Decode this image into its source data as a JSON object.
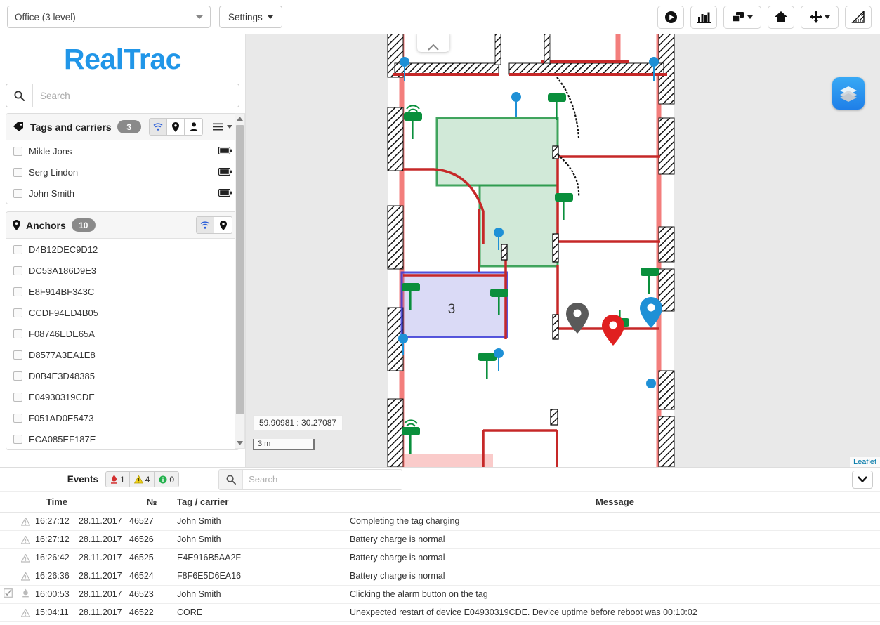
{
  "topbar": {
    "site_select": {
      "value": "Office (3 level)",
      "icon": "chevron-down-icon"
    },
    "settings_label": "Settings",
    "tools": [
      {
        "name": "play-record-button",
        "icon": "play-circle-icon"
      },
      {
        "name": "statistics-button",
        "icon": "bar-chart-icon"
      },
      {
        "name": "windows-layout-button",
        "icon": "windows-icon",
        "has_caret": true
      },
      {
        "name": "home-button",
        "icon": "home-icon"
      },
      {
        "name": "move-tool-button",
        "icon": "move-crosshair-icon",
        "has_caret": true
      },
      {
        "name": "measure-button",
        "icon": "ruler-triangle-icon"
      }
    ]
  },
  "sidebar": {
    "logo_text_1": "Real",
    "logo_text_2": "Trac",
    "logo_color": "#2196e8",
    "search": {
      "placeholder": "Search",
      "value": "",
      "icon": "search-icon"
    },
    "tags_panel": {
      "title": "Tags and carriers",
      "count": "3",
      "icon": "tag-icon",
      "filters": [
        {
          "name": "wifi-filter",
          "icon": "wifi-icon",
          "active": true
        },
        {
          "name": "location-filter",
          "icon": "map-pin-icon",
          "active": false
        },
        {
          "name": "person-filter",
          "icon": "person-icon",
          "active": false
        }
      ],
      "menu_icon": "hamburger-menu-icon",
      "items": [
        {
          "label": "Mikle Jons",
          "battery": "full"
        },
        {
          "label": "Serg Lindon",
          "battery": "full"
        },
        {
          "label": "John Smith",
          "battery": "full"
        }
      ]
    },
    "anchors_panel": {
      "title": "Anchors",
      "count": "10",
      "icon": "map-pin-icon",
      "filters": [
        {
          "name": "wifi-filter",
          "icon": "wifi-icon",
          "active": true
        },
        {
          "name": "location-filter",
          "icon": "map-pin-icon",
          "active": false
        }
      ],
      "items": [
        {
          "label": "D4B12DEC9D12"
        },
        {
          "label": "DC53A186D9E3"
        },
        {
          "label": "E8F914BF343C"
        },
        {
          "label": "CCDF94ED4B05"
        },
        {
          "label": "F08746EDE65A"
        },
        {
          "label": "D8577A3EA1E8"
        },
        {
          "label": "D0B4E3D48385"
        },
        {
          "label": "E04930319CDE"
        },
        {
          "label": "F051AD0E5473"
        },
        {
          "label": "ECA085EF187E"
        }
      ]
    }
  },
  "map": {
    "coordinates": "59.90981 : 30.27087",
    "scale_label": "3 m",
    "attribution": "Leaflet",
    "layers_button_icon": "layers-icon",
    "zone_label": "3",
    "zone_blue_color": "#3333cc",
    "zone_green_color": "#2e9b4e",
    "anchor_dot_color": "#2196e8",
    "alarm_pin_color": "#e02020",
    "idle_pin_color": "#666666",
    "tag_pin_color": "#1e90d6"
  },
  "events": {
    "title": "Events",
    "badges": [
      {
        "name": "alarm-count",
        "icon": "alarm-button-icon",
        "color": "#d32f2f",
        "value": "1"
      },
      {
        "name": "warning-count",
        "icon": "warning-triangle-icon",
        "color": "#e8c300",
        "value": "4"
      },
      {
        "name": "info-count",
        "icon": "info-circle-icon",
        "color": "#22b14c",
        "value": "0"
      }
    ],
    "search": {
      "placeholder": "Search",
      "value": "",
      "icon": "search-icon"
    },
    "collapse_icon": "chevron-down-icon",
    "columns": {
      "time": "Time",
      "number": "№",
      "tag": "Tag / carrier",
      "message": "Message"
    },
    "rows": [
      {
        "icon": "warning-triangle-icon",
        "checked": false,
        "time": "16:27:12",
        "date": "28.11.2017",
        "number": "46527",
        "tag": "John Smith",
        "message": "Completing the tag charging"
      },
      {
        "icon": "warning-triangle-icon",
        "checked": false,
        "time": "16:27:12",
        "date": "28.11.2017",
        "number": "46526",
        "tag": "John Smith",
        "message": "Battery charge is normal"
      },
      {
        "icon": "warning-triangle-icon",
        "checked": false,
        "time": "16:26:42",
        "date": "28.11.2017",
        "number": "46525",
        "tag": "E4E916B5AA2F",
        "message": "Battery charge is normal"
      },
      {
        "icon": "warning-triangle-icon",
        "checked": false,
        "time": "16:26:36",
        "date": "28.11.2017",
        "number": "46524",
        "tag": "F8F6E5D6EA16",
        "message": "Battery charge is normal"
      },
      {
        "icon": "alarm-button-icon",
        "checked": true,
        "time": "16:00:53",
        "date": "28.11.2017",
        "number": "46523",
        "tag": "John Smith",
        "message": "Clicking the alarm button on the tag"
      },
      {
        "icon": "warning-triangle-icon",
        "checked": false,
        "time": "15:04:11",
        "date": "28.11.2017",
        "number": "46522",
        "tag": "CORE",
        "message": "Unexpected restart of device E04930319CDE. Device uptime before reboot was 00:10:02"
      }
    ]
  }
}
